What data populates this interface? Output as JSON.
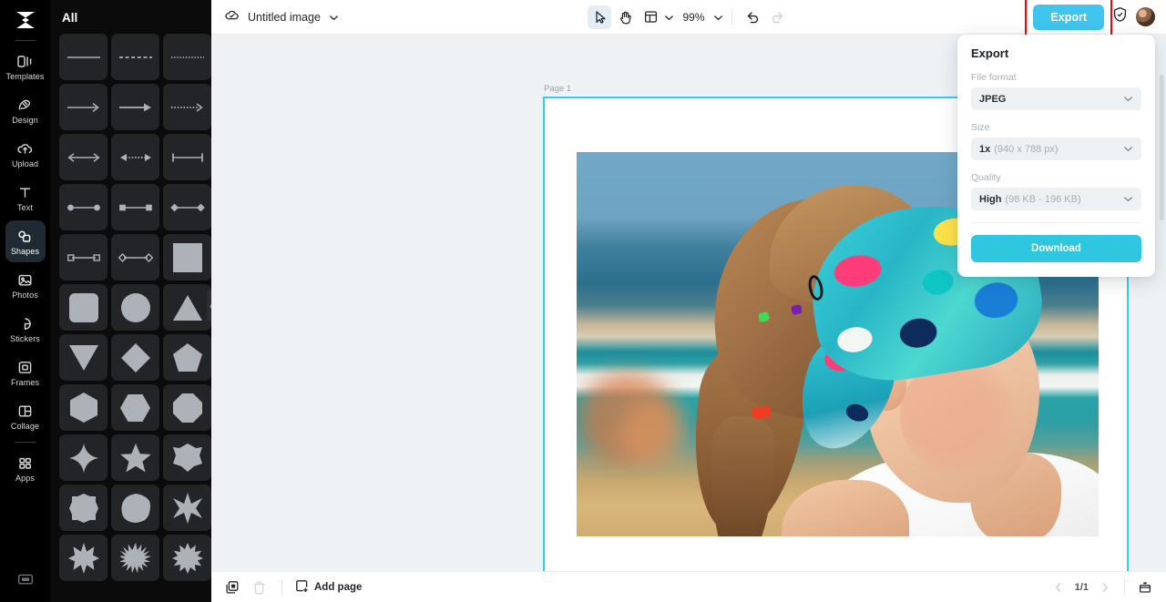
{
  "rail": {
    "logo_icon": "app-logo-icon",
    "items": [
      {
        "label": "Templates",
        "icon": "templates-icon",
        "active": false
      },
      {
        "label": "Design",
        "icon": "design-icon",
        "active": false
      },
      {
        "label": "Upload",
        "icon": "upload-cloud-icon",
        "active": false
      },
      {
        "label": "Text",
        "icon": "text-icon",
        "active": false
      },
      {
        "label": "Shapes",
        "icon": "shapes-icon",
        "active": true
      },
      {
        "label": "Photos",
        "icon": "photos-icon",
        "active": false
      },
      {
        "label": "Stickers",
        "icon": "stickers-icon",
        "active": false
      },
      {
        "label": "Frames",
        "icon": "frames-icon",
        "active": false
      },
      {
        "label": "Collage",
        "icon": "collage-icon",
        "active": false
      },
      {
        "label": "Apps",
        "icon": "apps-grid-icon",
        "active": false
      }
    ],
    "bottom_icon": "keyboard-shortcuts-icon"
  },
  "panel": {
    "title": "All",
    "collapse_handle_icon": "chevron-left-icon",
    "shapes": [
      "line-solid",
      "line-dashed",
      "line-dotted",
      "arrow-thin",
      "arrow-solid",
      "arrow-dotted",
      "double-arrow",
      "dotted-double-arrow",
      "bar-line",
      "circle-ended-line",
      "square-ended-line",
      "diamond-ended-line",
      "hollow-square-line",
      "hollow-diamond-line",
      "square",
      "rounded-square",
      "circle",
      "triangle-up",
      "triangle-down",
      "diamond",
      "pentagon",
      "hexagon-vertical",
      "hexagon-horizontal",
      "octagon",
      "four-point-star",
      "five-point-star",
      "six-point-blob",
      "eight-point-blob",
      "nine-point-blob",
      "eight-point-star",
      "ten-point-star",
      "sunburst-star",
      "twelve-point-star"
    ]
  },
  "topbar": {
    "cloud_icon": "cloud-saved-icon",
    "doc_title": "Untitled image",
    "title_chevron_icon": "chevron-down-icon",
    "tools": [
      {
        "name": "select-tool",
        "icon": "cursor-arrow-icon",
        "active": true
      },
      {
        "name": "hand-tool",
        "icon": "hand-icon",
        "active": false
      },
      {
        "name": "layout-tool",
        "icon": "layout-frame-icon",
        "active": false
      }
    ],
    "layout_chevron_icon": "chevron-down-icon",
    "zoom_value": "99%",
    "zoom_chevron_icon": "chevron-down-icon",
    "undo_icon": "undo-icon",
    "redo_icon": "redo-icon",
    "export_label": "Export",
    "shield_icon": "shield-check-icon",
    "avatar_name": "user-avatar"
  },
  "canvas": {
    "page_label": "Page 1",
    "image_alt": "girl-at-beach-photo"
  },
  "export_panel": {
    "title": "Export",
    "file_format_label": "File format",
    "file_format_value": "JPEG",
    "size_label": "Size",
    "size_value": "1x",
    "size_detail": "(940 x 788 px)",
    "quality_label": "Quality",
    "quality_value": "High",
    "quality_detail": "(98 KB - 196 KB)",
    "download_label": "Download",
    "chevron_icon": "chevron-down-icon",
    "accent_color": "#2fc7e0"
  },
  "bottombar": {
    "duplicate_icon": "duplicate-page-icon",
    "delete_icon": "trash-icon",
    "add_page_label": "Add page",
    "add_page_icon": "add-page-icon",
    "prev_icon": "chevron-left-icon",
    "page_indicator": "1/1",
    "next_icon": "chevron-right-icon",
    "view_icon": "page-manager-icon"
  },
  "highlight": {
    "color": "#ff0000",
    "target": "export-button"
  }
}
